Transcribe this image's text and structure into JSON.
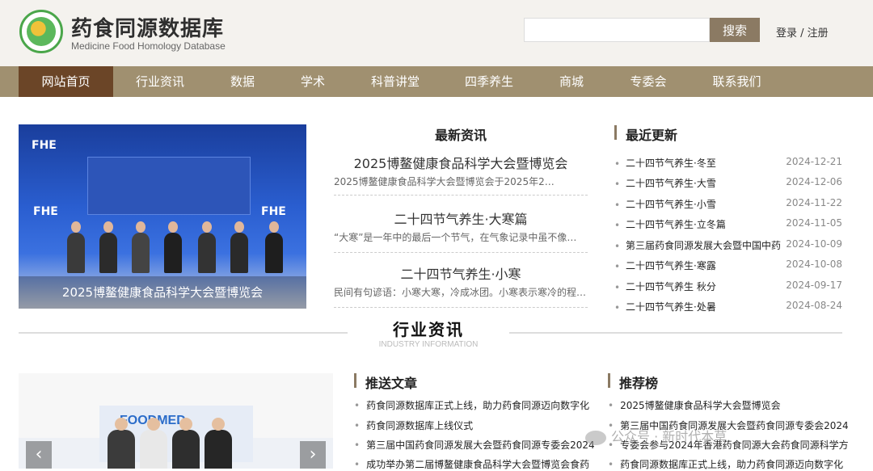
{
  "header": {
    "title": "药食同源数据库",
    "subtitle": "Medicine Food Homology Database",
    "search_button": "搜索",
    "search_placeholder": "",
    "login": "登录 / 注册"
  },
  "nav": [
    "网站首页",
    "行业资讯",
    "数据",
    "学术",
    "科普讲堂",
    "四季养生",
    "商城",
    "专委会",
    "联系我们"
  ],
  "banner": {
    "caption": "2025博鳌健康食品科学大会暨博览会",
    "logo_text": "FHE"
  },
  "latest_news": {
    "heading": "最新资讯",
    "items": [
      {
        "title": "2025博鳌健康食品科学大会暨博览会",
        "desc": "2025博鳌健康食品科学大会暨博览会于2025年2…"
      },
      {
        "title": "二十四节气养生·大寒篇",
        "desc": "“大寒”是一年中的最后一个节气，在气象记录中虽不像…"
      },
      {
        "title": "二十四节气养生·小寒",
        "desc": "民间有句谚语：小寒大寒，冷成冰团。小寒表示寒冷的程…"
      }
    ]
  },
  "recent_updates": {
    "heading": "最近更新",
    "items": [
      {
        "title": "二十四节气养生·冬至",
        "date": "2024-12-21"
      },
      {
        "title": "二十四节气养生·大雪",
        "date": "2024-12-06"
      },
      {
        "title": "二十四节气养生·小雪",
        "date": "2024-11-22"
      },
      {
        "title": "二十四节气养生·立冬篇",
        "date": "2024-11-05"
      },
      {
        "title": "第三届药食同源发展大会暨中国中药",
        "date": "2024-10-09"
      },
      {
        "title": "二十四节气养生·寒露",
        "date": "2024-10-08"
      },
      {
        "title": "二十四节气养生 秋分",
        "date": "2024-09-17"
      },
      {
        "title": "二十四节气养生·处暑",
        "date": "2024-08-24"
      }
    ]
  },
  "industry": {
    "title": "行业资讯",
    "subtitle": "INDUSTRY INFORMATION"
  },
  "featured_articles": {
    "heading": "推送文章",
    "items": [
      "药食同源数据库正式上线，助力药食同源迈向数字化",
      "药食同源数据库上线仪式",
      "第三届中国药食同源发展大会暨药食同源专委会2024",
      "成功举办第二届博鳌健康食品科学大会暨博览会食药"
    ]
  },
  "recommended": {
    "heading": "推荐榜",
    "items": [
      "2025博鳌健康食品科学大会暨博览会",
      "第三届中国药食同源发展大会暨药食同源专委会2024",
      "专委会参与2024年香港药食同源大会药食同源科学方",
      "药食同源数据库正式上线，助力药食同源迈向数字化"
    ]
  },
  "banner2": {
    "brand": "FOODMED",
    "prev": "‹",
    "next": "›"
  },
  "watermark": "公众号 · 新时代本草"
}
